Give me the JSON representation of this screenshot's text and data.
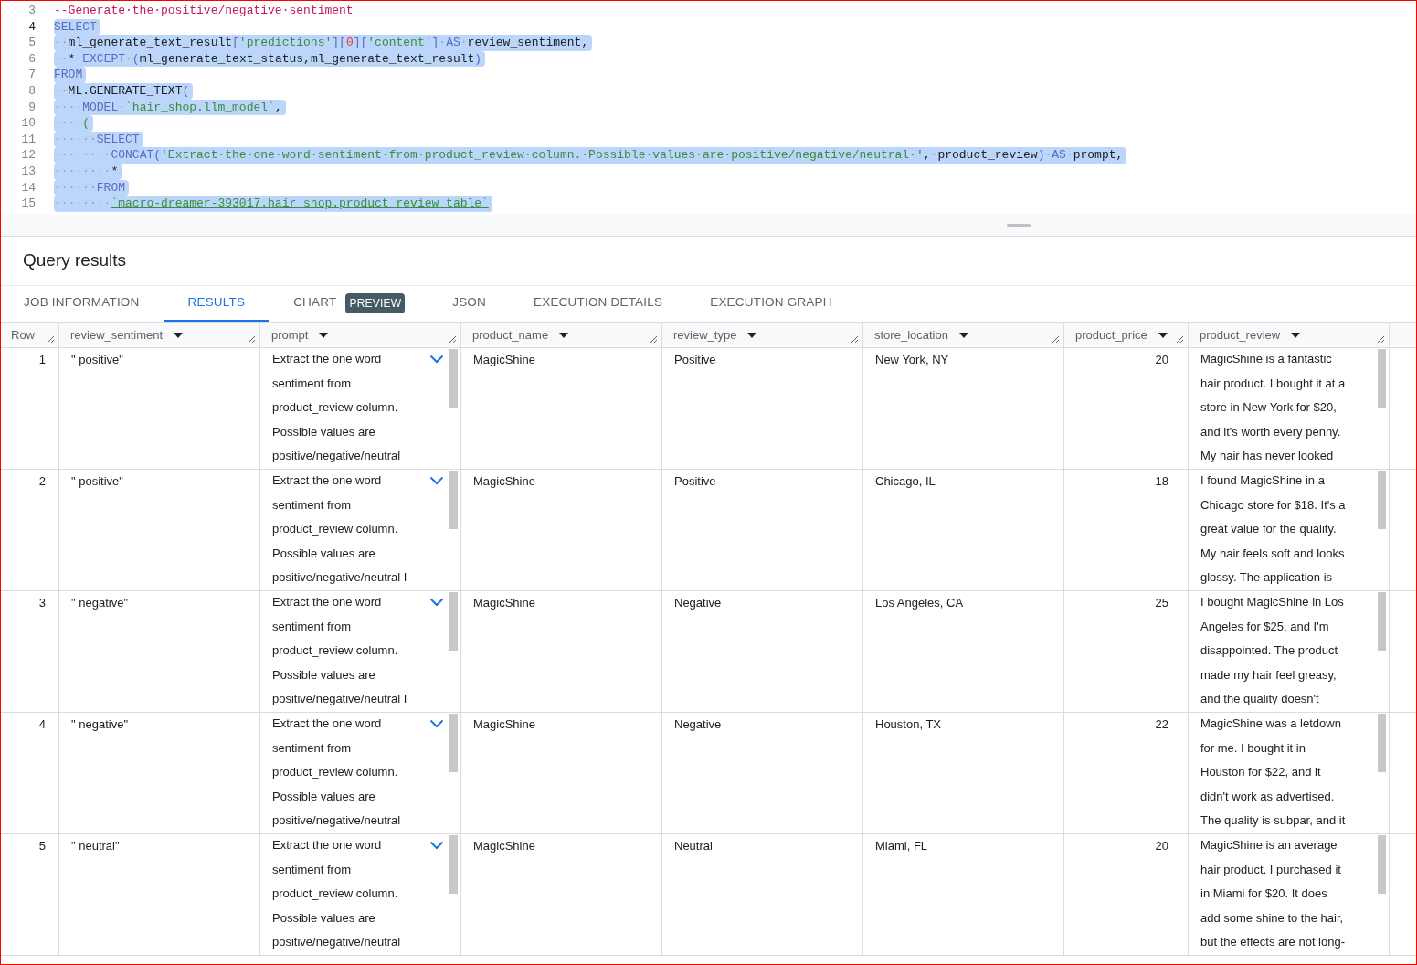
{
  "editor": {
    "lines": [
      {
        "number": "3",
        "selected": false,
        "current": false,
        "tokens": [
          {
            "kind": "comment",
            "text": "--Generate·the·positive/negative·sentiment"
          }
        ]
      },
      {
        "number": "4",
        "selected": true,
        "current": true,
        "tokens": [
          {
            "kind": "keyword",
            "text": "SELECT"
          }
        ]
      },
      {
        "number": "5",
        "selected": true,
        "current": false,
        "tokens": [
          {
            "kind": "space",
            "text": "··"
          },
          {
            "kind": "plain",
            "text": "ml_generate_text_result"
          },
          {
            "kind": "keyword",
            "text": "["
          },
          {
            "kind": "string",
            "text": "'predictions'"
          },
          {
            "kind": "keyword",
            "text": "]["
          },
          {
            "kind": "number",
            "text": "0"
          },
          {
            "kind": "keyword",
            "text": "]["
          },
          {
            "kind": "string",
            "text": "'content'"
          },
          {
            "kind": "keyword",
            "text": "]"
          },
          {
            "kind": "space",
            "text": "·"
          },
          {
            "kind": "keyword",
            "text": "AS"
          },
          {
            "kind": "space",
            "text": "·"
          },
          {
            "kind": "plain",
            "text": "review_sentiment,"
          }
        ]
      },
      {
        "number": "6",
        "selected": true,
        "current": false,
        "tokens": [
          {
            "kind": "space",
            "text": "··"
          },
          {
            "kind": "plain",
            "text": "*"
          },
          {
            "kind": "space",
            "text": "·"
          },
          {
            "kind": "keyword",
            "text": "EXCEPT"
          },
          {
            "kind": "space",
            "text": "·"
          },
          {
            "kind": "keyword",
            "text": "("
          },
          {
            "kind": "plain",
            "text": "ml_generate_text_status,ml_generate_text_result"
          },
          {
            "kind": "keyword",
            "text": ")"
          }
        ]
      },
      {
        "number": "7",
        "selected": true,
        "current": false,
        "tokens": [
          {
            "kind": "keyword",
            "text": "FROM"
          }
        ]
      },
      {
        "number": "8",
        "selected": true,
        "current": false,
        "tokens": [
          {
            "kind": "space",
            "text": "··"
          },
          {
            "kind": "plain",
            "text": "ML.GENERATE_TEXT"
          },
          {
            "kind": "keyword",
            "text": "("
          }
        ]
      },
      {
        "number": "9",
        "selected": true,
        "current": false,
        "tokens": [
          {
            "kind": "space",
            "text": "····"
          },
          {
            "kind": "keyword",
            "text": "MODEL"
          },
          {
            "kind": "space",
            "text": "·"
          },
          {
            "kind": "string",
            "text": "`hair_shop.llm_model`"
          },
          {
            "kind": "plain",
            "text": ","
          }
        ]
      },
      {
        "number": "10",
        "selected": true,
        "current": false,
        "tokens": [
          {
            "kind": "space",
            "text": "····"
          },
          {
            "kind": "string",
            "text": "("
          }
        ]
      },
      {
        "number": "11",
        "selected": true,
        "current": false,
        "tokens": [
          {
            "kind": "space",
            "text": "······"
          },
          {
            "kind": "keyword",
            "text": "SELECT"
          }
        ]
      },
      {
        "number": "12",
        "selected": true,
        "current": false,
        "tokens": [
          {
            "kind": "space",
            "text": "········"
          },
          {
            "kind": "keyword",
            "text": "CONCAT("
          },
          {
            "kind": "string",
            "text": "'Extract·the·one·word·sentiment·from·product_review·column.·Possible·values·are·positive/negative/neutral·'"
          },
          {
            "kind": "plain",
            "text": ","
          },
          {
            "kind": "space",
            "text": "·"
          },
          {
            "kind": "plain",
            "text": "product_review"
          },
          {
            "kind": "keyword",
            "text": ")"
          },
          {
            "kind": "space",
            "text": "·"
          },
          {
            "kind": "keyword",
            "text": "AS"
          },
          {
            "kind": "space",
            "text": "·"
          },
          {
            "kind": "plain",
            "text": "prompt,"
          }
        ]
      },
      {
        "number": "13",
        "selected": true,
        "current": false,
        "tokens": [
          {
            "kind": "space",
            "text": "········"
          },
          {
            "kind": "plain",
            "text": "*"
          }
        ]
      },
      {
        "number": "14",
        "selected": true,
        "current": false,
        "tokens": [
          {
            "kind": "space",
            "text": "······"
          },
          {
            "kind": "keyword",
            "text": "FROM"
          }
        ]
      },
      {
        "number": "15",
        "selected": true,
        "current": false,
        "tokens": [
          {
            "kind": "space",
            "text": "········"
          },
          {
            "kind": "link",
            "text": "`macro-dreamer-393017.hair_shop.product_review_table`"
          }
        ]
      }
    ]
  },
  "results": {
    "title": "Query results",
    "tabs": [
      {
        "label": "JOB INFORMATION",
        "selected": false
      },
      {
        "label": "RESULTS",
        "selected": true
      },
      {
        "label": "CHART",
        "badge": "PREVIEW",
        "selected": false
      },
      {
        "label": "JSON",
        "selected": false
      },
      {
        "label": "EXECUTION DETAILS",
        "selected": false
      },
      {
        "label": "EXECUTION GRAPH",
        "selected": false
      }
    ],
    "table": {
      "columns": [
        "Row",
        "review_sentiment",
        "prompt",
        "product_name",
        "review_type",
        "store_location",
        "product_price",
        "product_review"
      ],
      "rows": [
        {
          "row": "1",
          "review_sentiment": "\" positive\"",
          "prompt": [
            "Extract the one word",
            "sentiment from",
            "product_review column.",
            "Possible values are",
            "positive/negative/neutral"
          ],
          "product_name": "MagicShine",
          "review_type": "Positive",
          "store_location": "New York, NY",
          "product_price": "20",
          "product_review": [
            "MagicShine is a fantastic",
            "hair product. I bought it at a",
            "store in New York for $20,",
            "and it's worth every penny.",
            "My hair has never looked"
          ]
        },
        {
          "row": "2",
          "review_sentiment": "\" positive\"",
          "prompt": [
            "Extract the one word",
            "sentiment from",
            "product_review column.",
            "Possible values are",
            "positive/negative/neutral I"
          ],
          "product_name": "MagicShine",
          "review_type": "Positive",
          "store_location": "Chicago, IL",
          "product_price": "18",
          "product_review": [
            "I found MagicShine in a",
            "Chicago store for $18. It's a",
            "great value for the quality.",
            "My hair feels soft and looks",
            "glossy. The application is"
          ]
        },
        {
          "row": "3",
          "review_sentiment": "\" negative\"",
          "prompt": [
            "Extract the one word",
            "sentiment from",
            "product_review column.",
            "Possible values are",
            "positive/negative/neutral I"
          ],
          "product_name": "MagicShine",
          "review_type": "Negative",
          "store_location": "Los Angeles, CA",
          "product_price": "25",
          "product_review": [
            "I bought MagicShine in Los",
            "Angeles for $25, and I'm",
            "disappointed. The product",
            "made my hair feel greasy,",
            "and the quality doesn't"
          ]
        },
        {
          "row": "4",
          "review_sentiment": "\" negative\"",
          "prompt": [
            "Extract the one word",
            "sentiment from",
            "product_review column.",
            "Possible values are",
            "positive/negative/neutral"
          ],
          "product_name": "MagicShine",
          "review_type": "Negative",
          "store_location": "Houston, TX",
          "product_price": "22",
          "product_review": [
            "MagicShine was a letdown",
            "for me. I bought it in",
            "Houston for $22, and it",
            "didn't work as advertised.",
            "The quality is subpar, and it"
          ]
        },
        {
          "row": "5",
          "review_sentiment": "\" neutral\"",
          "prompt": [
            "Extract the one word",
            "sentiment from",
            "product_review column.",
            "Possible values are",
            "positive/negative/neutral"
          ],
          "product_name": "MagicShine",
          "review_type": "Neutral",
          "store_location": "Miami, FL",
          "product_price": "20",
          "product_review": [
            "MagicShine is an average",
            "hair product. I purchased it",
            "in Miami for $20. It does",
            "add some shine to the hair,",
            "but the effects are not long-"
          ]
        }
      ]
    }
  }
}
